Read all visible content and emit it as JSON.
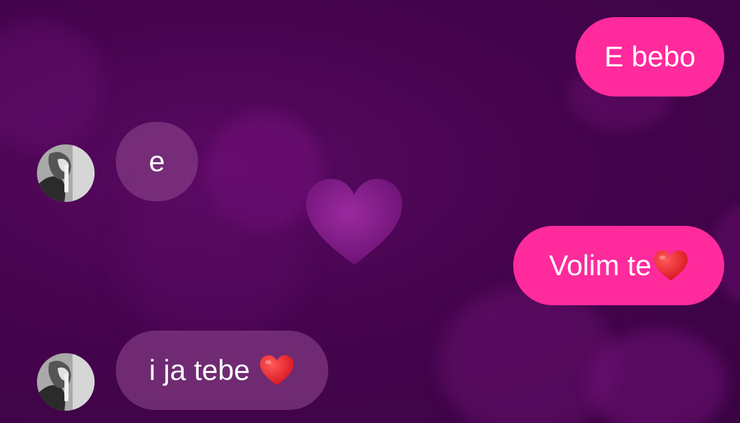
{
  "chat": {
    "messages": [
      {
        "direction": "outgoing",
        "text": "E bebo"
      },
      {
        "direction": "incoming",
        "text": "e"
      },
      {
        "direction": "outgoing",
        "text": "Volim te",
        "emoji": "heart-emoji"
      },
      {
        "direction": "incoming",
        "text": "i ja tebe ",
        "emoji": "heart-emoji"
      }
    ]
  },
  "colors": {
    "outgoing_bubble": "#ff2a9c",
    "incoming_bubble": "#8a428a",
    "background": "#46044e",
    "heart": "#e0202a"
  },
  "icons": {
    "contact_avatar": "avatar-photo",
    "background_decor": "heart-icon"
  }
}
